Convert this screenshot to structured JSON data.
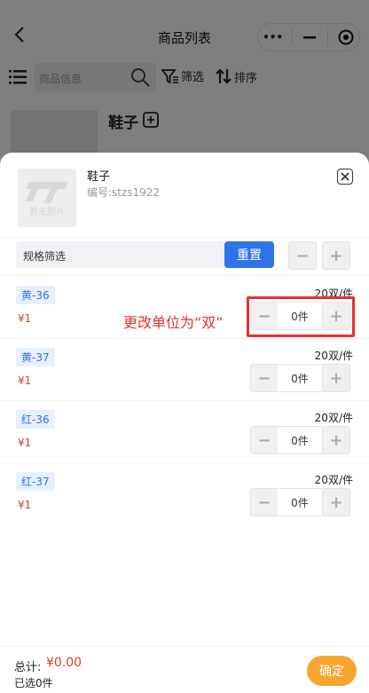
{
  "nav": {
    "title": "商品列表",
    "capsule_more": "•••"
  },
  "toolbar": {
    "search_placeholder": "商品信息",
    "filter_label": "筛选",
    "sort_label": "排序"
  },
  "background_item": {
    "name": "鞋子"
  },
  "product": {
    "name": "鞋子",
    "code": "编号:stzs1922",
    "thumb_text": "暂无图片"
  },
  "spec_filter": {
    "label": "规格筛选",
    "reset_label": "重置"
  },
  "specs": [
    {
      "tag": "黄-36",
      "unit": "20双/件",
      "price": "¥1",
      "qty": "0件"
    },
    {
      "tag": "黄-37",
      "unit": "20双/件",
      "price": "¥1",
      "qty": "0件"
    },
    {
      "tag": "红-36",
      "unit": "20双/件",
      "price": "¥1",
      "qty": "0件"
    },
    {
      "tag": "红-37",
      "unit": "20双/件",
      "price": "¥1",
      "qty": "0件"
    }
  ],
  "annotation": {
    "text": "更改单位为“双”"
  },
  "footer": {
    "total_label": "总计:",
    "total_value": "¥0.00",
    "selected": "已选0件",
    "confirm_label": "确定"
  },
  "colors": {
    "accent_blue": "#2e74e6",
    "price_red": "#e03c1f",
    "confirm_orange": "#f7a531",
    "annotation_red": "#e6312b"
  }
}
